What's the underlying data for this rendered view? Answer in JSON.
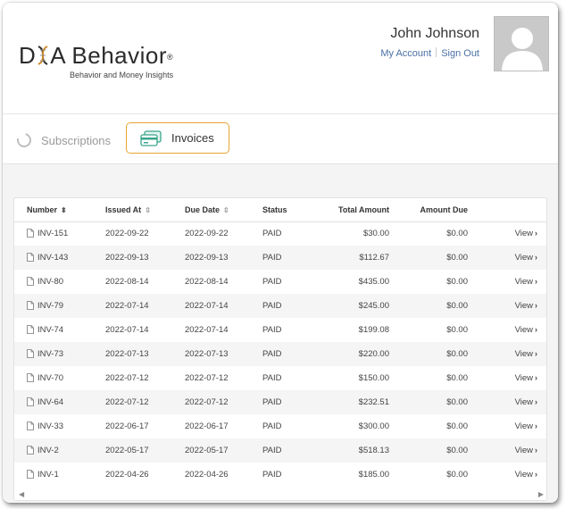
{
  "header": {
    "logo_text": "DNA Behavior",
    "logo_reg": "®",
    "logo_tagline": "Behavior and Money Insights",
    "user_name": "John Johnson",
    "my_account": "My Account",
    "sign_out": "Sign Out",
    "avatar_icon": "user-silhouette-icon"
  },
  "tabs": {
    "subscriptions": "Subscriptions",
    "invoices": "Invoices",
    "active": "invoices",
    "accent_color": "#e8a431"
  },
  "table": {
    "columns": {
      "number": "Number",
      "issued_at": "Issued At",
      "due_date": "Due Date",
      "status": "Status",
      "total_amount": "Total Amount",
      "amount_due": "Amount Due"
    },
    "sorted_by": "number",
    "view_label": "View",
    "rows": [
      {
        "number": "INV-151",
        "issued": "2022-09-22",
        "due": "2022-09-22",
        "status": "PAID",
        "total": "$30.00",
        "amount_due": "$0.00"
      },
      {
        "number": "INV-143",
        "issued": "2022-09-13",
        "due": "2022-09-13",
        "status": "PAID",
        "total": "$112.67",
        "amount_due": "$0.00"
      },
      {
        "number": "INV-80",
        "issued": "2022-08-14",
        "due": "2022-08-14",
        "status": "PAID",
        "total": "$435.00",
        "amount_due": "$0.00"
      },
      {
        "number": "INV-79",
        "issued": "2022-07-14",
        "due": "2022-07-14",
        "status": "PAID",
        "total": "$245.00",
        "amount_due": "$0.00"
      },
      {
        "number": "INV-74",
        "issued": "2022-07-14",
        "due": "2022-07-14",
        "status": "PAID",
        "total": "$199.08",
        "amount_due": "$0.00"
      },
      {
        "number": "INV-73",
        "issued": "2022-07-13",
        "due": "2022-07-13",
        "status": "PAID",
        "total": "$220.00",
        "amount_due": "$0.00"
      },
      {
        "number": "INV-70",
        "issued": "2022-07-12",
        "due": "2022-07-12",
        "status": "PAID",
        "total": "$150.00",
        "amount_due": "$0.00"
      },
      {
        "number": "INV-64",
        "issued": "2022-07-12",
        "due": "2022-07-12",
        "status": "PAID",
        "total": "$232.51",
        "amount_due": "$0.00"
      },
      {
        "number": "INV-33",
        "issued": "2022-06-17",
        "due": "2022-06-17",
        "status": "PAID",
        "total": "$300.00",
        "amount_due": "$0.00"
      },
      {
        "number": "INV-2",
        "issued": "2022-05-17",
        "due": "2022-05-17",
        "status": "PAID",
        "total": "$518.13",
        "amount_due": "$0.00"
      },
      {
        "number": "INV-1",
        "issued": "2022-04-26",
        "due": "2022-04-26",
        "status": "PAID",
        "total": "$185.00",
        "amount_due": "$0.00"
      }
    ]
  }
}
